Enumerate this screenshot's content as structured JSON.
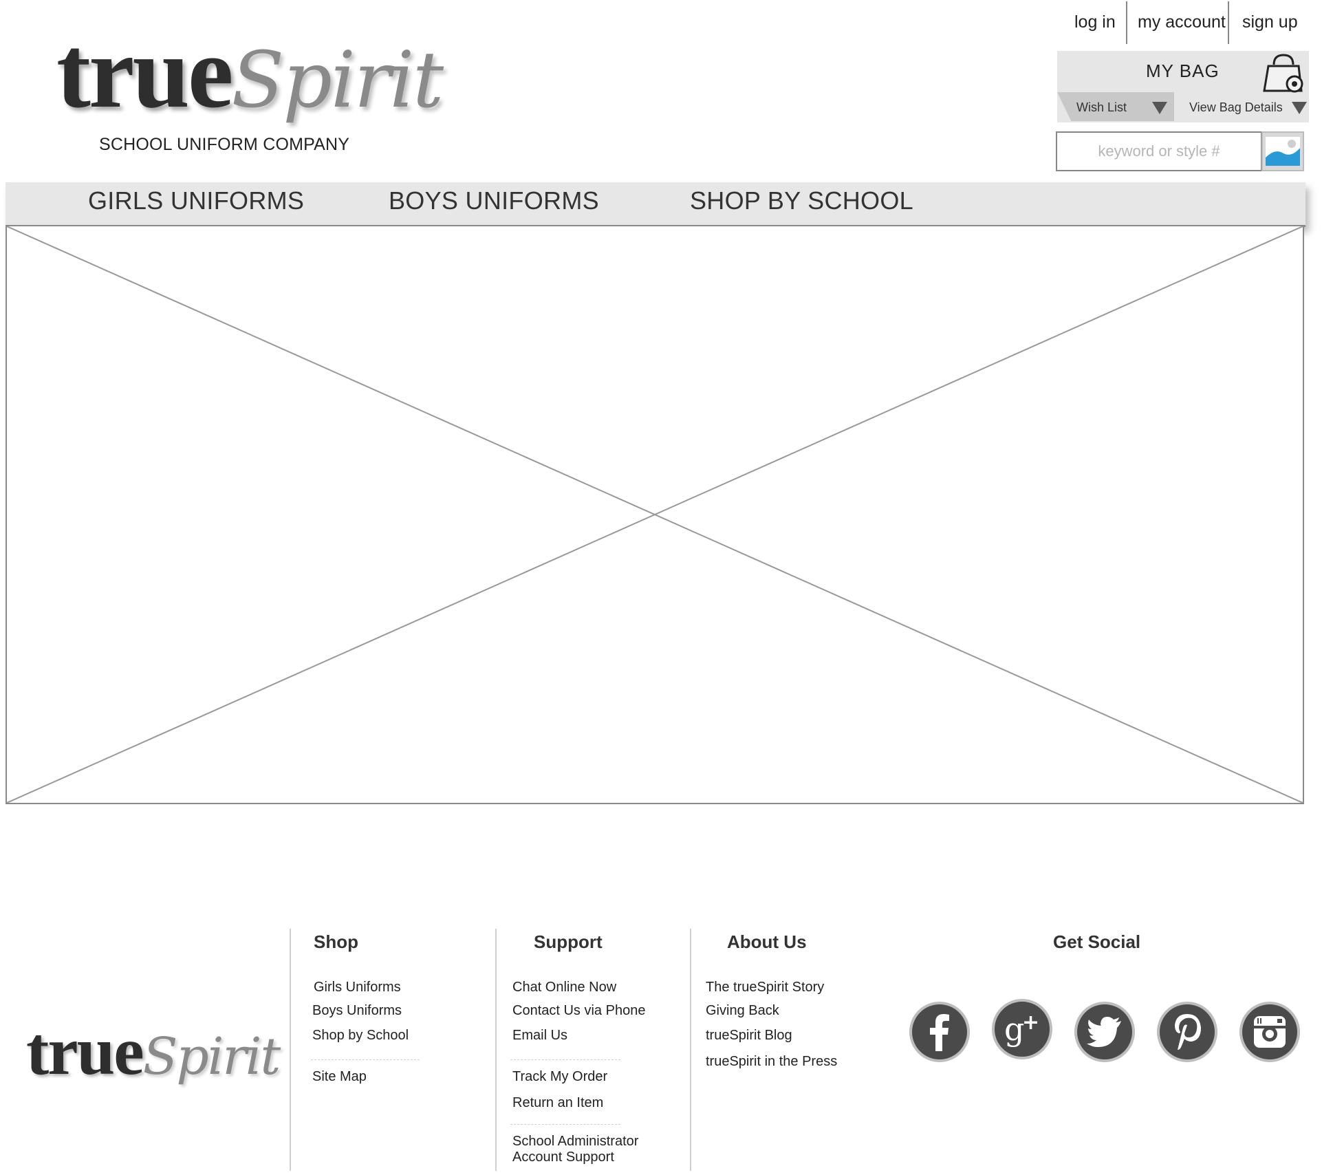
{
  "brand": {
    "logo_part1": "true",
    "logo_part2": "Spirit",
    "tagline": "SCHOOL UNIFORM COMPANY"
  },
  "account_links": {
    "login": "log in",
    "my_account": "my account",
    "signup": "sign up"
  },
  "bag": {
    "title": "MY  BAG",
    "wish_list": "Wish List",
    "view_details": "View Bag Details"
  },
  "search": {
    "placeholder": "keyword or style #"
  },
  "nav": {
    "items": [
      "GIRLS UNIFORMS",
      "BOYS UNIFORMS",
      "SHOP BY SCHOOL"
    ]
  },
  "footer": {
    "shop": {
      "heading": "Shop",
      "links": [
        "Girls Uniforms",
        "Boys Uniforms",
        "Shop by School",
        "Site Map"
      ]
    },
    "support": {
      "heading": "Support",
      "links": [
        "Chat Online Now",
        "Contact Us via Phone",
        "Email Us",
        "Track My Order",
        "Return an Item",
        "School Administrator",
        "Account Support"
      ]
    },
    "about": {
      "heading": "About Us",
      "links": [
        "The trueSpirit Story",
        "Giving Back",
        "trueSpirit Blog",
        "trueSpirit in the Press"
      ]
    },
    "social": {
      "heading": "Get Social",
      "icons": [
        "facebook-icon",
        "google-plus-icon",
        "twitter-icon",
        "pinterest-icon",
        "instagram-icon"
      ]
    }
  },
  "colors": {
    "nav_bg": "#e7e7e7",
    "social_bg": "#4a4a4a",
    "search_image_blue": "#2a9ad6"
  }
}
